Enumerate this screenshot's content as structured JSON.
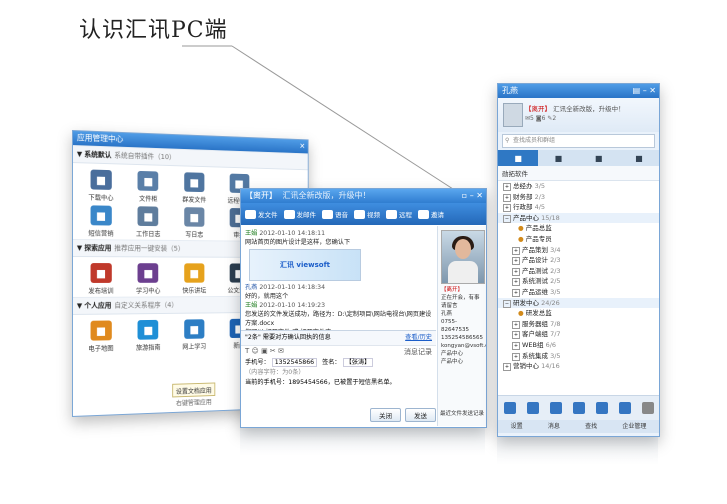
{
  "page_title": "认识汇讯PC端",
  "app_center": {
    "title": "应用管理中心",
    "sections": [
      {
        "title": "系统默认",
        "subtitle": "系统自带插件（10）",
        "apps": [
          {
            "label": "下载中心",
            "icon": "download-icon",
            "color": "#4a6e9c"
          },
          {
            "label": "文件柜",
            "icon": "file-cabinet-icon",
            "color": "#5a7fa8"
          },
          {
            "label": "群发文件",
            "icon": "mass-file-icon",
            "color": "#4f75a0"
          },
          {
            "label": "远程中心",
            "icon": "remote-icon",
            "color": "#5379a3"
          },
          {
            "label": "",
            "icon": "blank-icon",
            "color": "#ffffff"
          },
          {
            "label": "短信营销",
            "icon": "sms-marketing-icon",
            "color": "#3a87c9"
          },
          {
            "label": "工作日志",
            "icon": "work-log-icon",
            "color": "#5f7d9d"
          },
          {
            "label": "写日志",
            "icon": "write-log-icon",
            "color": "#6a86a6"
          },
          {
            "label": "审批",
            "icon": "approval-icon",
            "color": "#4e6f96"
          },
          {
            "label": "",
            "icon": "blank-icon",
            "color": "#ffffff"
          }
        ]
      },
      {
        "title": "探索应用",
        "subtitle": "推荐应用一键安装（5）",
        "apps": [
          {
            "label": "发布培训",
            "icon": "training-icon",
            "color": "#c0392b"
          },
          {
            "label": "学习中心",
            "icon": "learning-icon",
            "color": "#6c3f8f"
          },
          {
            "label": "快乐讲坛",
            "icon": "forum-icon",
            "color": "#e6a21c"
          },
          {
            "label": "公文流转",
            "icon": "document-flow-icon",
            "color": "#2c3e50"
          }
        ]
      },
      {
        "title": "个人应用",
        "subtitle": "自定义关系程序（4）",
        "apps": [
          {
            "label": "电子地图",
            "icon": "map-icon",
            "color": "#e08a1e"
          },
          {
            "label": "旅游指南",
            "icon": "travel-icon",
            "color": "#1e8fd6"
          },
          {
            "label": "网上学习",
            "icon": "elearning-icon",
            "color": "#2d7ec4"
          },
          {
            "label": "新闻",
            "icon": "news-icon",
            "color": "#1e64b5"
          }
        ]
      }
    ],
    "tooltip": "设置文档应用",
    "tooltip_sub": "右键管理应用"
  },
  "chat": {
    "title_user": "【离开】",
    "title_signature": "汇讯全新改版，升级中！",
    "toolbar": [
      "发文件",
      "发邮件",
      "语音",
      "视频",
      "远程",
      "邀请"
    ],
    "messages": [
      {
        "sender": "王娟",
        "time": "2012-01-10  14:18:11",
        "lines": [
          "网站首页的图片设计是这样，您确认下"
        ],
        "banner": "汇讯 viewsoft"
      },
      {
        "sender": "孔燕",
        "time": "2012-01-10  14:18:34",
        "lines": [
          "好的，就用这个"
        ]
      },
      {
        "sender": "王娟",
        "time": "2012-01-10  14:19:23",
        "lines": [
          "您发送的文件发送成功，路径为：D:\\定制项目\\网站电视台\\网页建设方案.docx",
          "您可以  打开文件  或  打开文件夹"
        ]
      }
    ],
    "sms": {
      "header": "\"2条\" 需要对方确认回执的信息",
      "header_link": "查看/历史",
      "phone_label": "手机号：",
      "phone_value": "1352545866",
      "sign_label": "签名：",
      "sign_value": "【张涛】",
      "counter": "（内容字符：为0条）",
      "line2": "当前的手机号：1895454566，已被置于短信黑名单。",
      "history": "消息记录"
    },
    "send_label": "发送",
    "close_label": "关闭",
    "recent_label": "最近文件发送记录",
    "profile": {
      "status": "【离开】",
      "company": "正在开会，有事请留言",
      "name": "孔燕",
      "phone": "0755-82647535",
      "mobile": "135254586565",
      "email": "kongyan@vsoft.com",
      "dept": "产品中心",
      "position": "产品中心"
    }
  },
  "contacts": {
    "title": "孔燕",
    "user": "【离开】",
    "signature": "汇讯全新改版，升级中！",
    "badges": [
      "5",
      "6",
      "2"
    ],
    "search_placeholder": "查找成员和群组",
    "tab_icons": [
      "contacts-icon",
      "group-icon",
      "chat-icon",
      "message-icon"
    ],
    "list_header": "勋拓软件",
    "tree": [
      {
        "label": "总经办",
        "count": "3/5",
        "level": 0
      },
      {
        "label": "财务部",
        "count": "2/3",
        "level": 0
      },
      {
        "label": "行政部",
        "count": "4/5",
        "level": 0
      },
      {
        "label": "产品中心",
        "count": "15/18",
        "level": 0
      },
      {
        "label": "产品总监",
        "count": "",
        "level": 2
      },
      {
        "label": "产品专员",
        "count": "",
        "level": 2
      },
      {
        "label": "产品策划",
        "count": "3/4",
        "level": 1
      },
      {
        "label": "产品设计",
        "count": "2/3",
        "level": 1
      },
      {
        "label": "产品测试",
        "count": "2/3",
        "level": 1
      },
      {
        "label": "系统测试",
        "count": "2/5",
        "level": 1
      },
      {
        "label": "产品运维",
        "count": "3/5",
        "level": 1
      },
      {
        "label": "研发中心",
        "count": "24/26",
        "level": 0
      },
      {
        "label": "研发总监",
        "count": "",
        "level": 2
      },
      {
        "label": "服务器组",
        "count": "7/8",
        "level": 1
      },
      {
        "label": "客户端组",
        "count": "7/7",
        "level": 1
      },
      {
        "label": "WEB组",
        "count": "6/6",
        "level": 1
      },
      {
        "label": "系统集成",
        "count": "3/5",
        "level": 1
      },
      {
        "label": "营销中心",
        "count": "14/16",
        "level": 0
      }
    ],
    "bottom": [
      "设置",
      "消息",
      "查找",
      "企业管理"
    ]
  }
}
